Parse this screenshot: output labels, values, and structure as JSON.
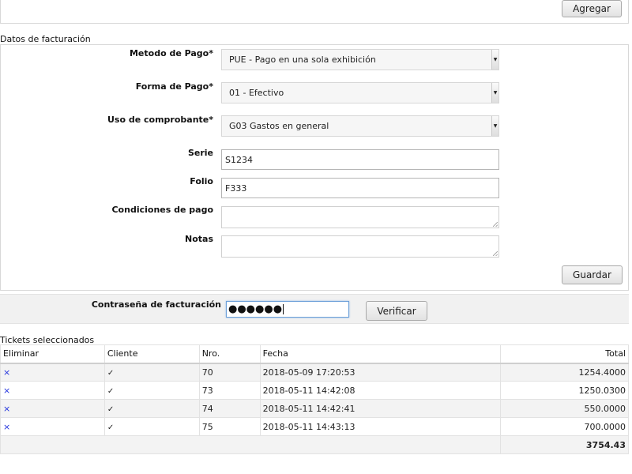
{
  "top": {
    "add_button": "Agregar"
  },
  "billing": {
    "section_title": "Datos de facturación",
    "metodo_pago": {
      "label": "Metodo de Pago*",
      "value": "PUE - Pago en una sola exhibición"
    },
    "forma_pago": {
      "label": "Forma de Pago*",
      "value": "01 - Efectivo"
    },
    "uso_comprobante": {
      "label": "Uso de comprobante*",
      "value": "G03 Gastos en general"
    },
    "serie": {
      "label": "Serie",
      "value": "S1234"
    },
    "folio": {
      "label": "Folio",
      "value": "F333"
    },
    "condiciones": {
      "label": "Condiciones de pago",
      "value": ""
    },
    "notas": {
      "label": "Notas",
      "value": ""
    },
    "save_button": "Guardar"
  },
  "password": {
    "label": "Contraseña de facturación",
    "masked_value": "●●●●●●",
    "verify_button": "Verificar"
  },
  "tickets": {
    "section_title": "Tickets seleccionados",
    "headers": {
      "eliminar": "Eliminar",
      "cliente": "Cliente",
      "nro": "Nro.",
      "fecha": "Fecha",
      "total": "Total"
    },
    "rows": [
      {
        "delete": "×",
        "cliente": "✓",
        "nro": "70",
        "fecha": "2018-05-09 17:20:53",
        "total": "1254.4000"
      },
      {
        "delete": "×",
        "cliente": "✓",
        "nro": "73",
        "fecha": "2018-05-11 14:42:08",
        "total": "1250.0300"
      },
      {
        "delete": "×",
        "cliente": "✓",
        "nro": "74",
        "fecha": "2018-05-11 14:42:41",
        "total": "550.0000"
      },
      {
        "delete": "×",
        "cliente": "✓",
        "nro": "75",
        "fecha": "2018-05-11 14:43:13",
        "total": "700.0000"
      }
    ],
    "grand_total": "3754.43"
  },
  "icons": {
    "delete": "x-icon",
    "client": "check-icon",
    "select_arrow": "dropdown-arrow-icon"
  },
  "colors": {
    "delete_icon": "#2233dd",
    "focus_border": "#6b9fd8"
  }
}
